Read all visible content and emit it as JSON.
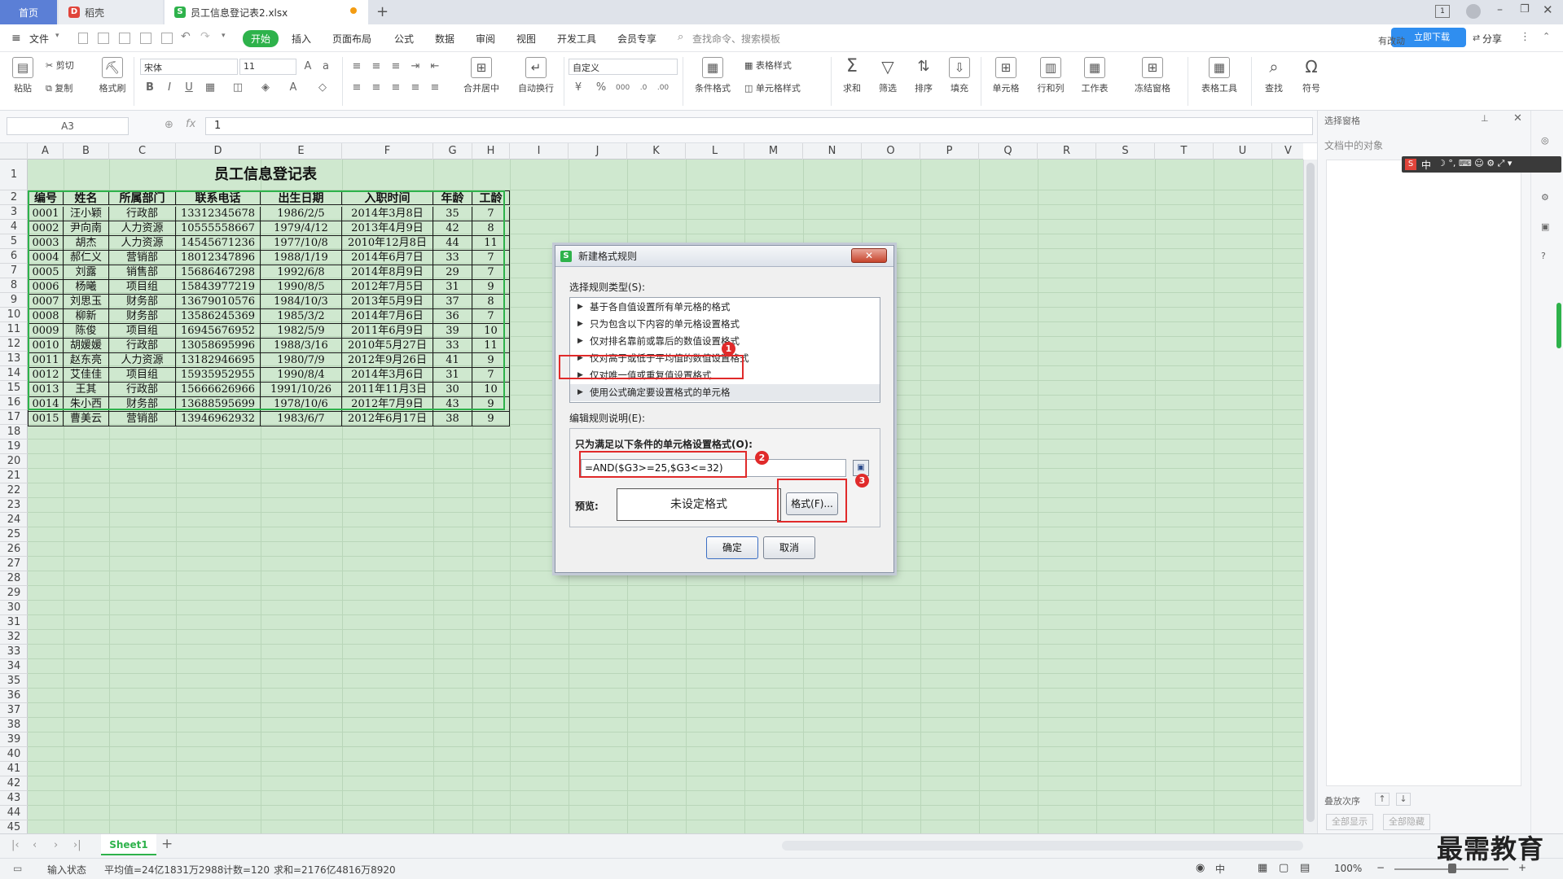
{
  "titlebar": {
    "tabs": [
      {
        "label": "首页"
      },
      {
        "label": "稻壳"
      },
      {
        "label": "员工信息登记表2.xlsx"
      }
    ],
    "new_tab": "+"
  },
  "menubar": {
    "file": "文件",
    "items": [
      "开始",
      "插入",
      "页面布局",
      "公式",
      "数据",
      "审阅",
      "视图",
      "开发工具",
      "会员专享"
    ],
    "search_placeholder": "查找命令、搜索模板",
    "right_items": [
      "有改动",
      "分享"
    ],
    "float_btn": "立即下载"
  },
  "ribbon": {
    "paste": "粘贴",
    "cut": "剪切",
    "copy": "复制",
    "format_painter": "格式刷",
    "font_name": "宋体",
    "font_size": "11",
    "merge_center": "合并居中",
    "wrap_text": "自动换行",
    "number_format": "自定义",
    "table_style": "表格样式",
    "cond_format": "条件格式",
    "cell_style": "单元格样式",
    "sum": "求和",
    "filter": "筛选",
    "sort": "排序",
    "fill": "填充",
    "cell": "单元格",
    "row_col": "行和列",
    "worksheet": "工作表",
    "freeze": "冻结窗格",
    "table_tools": "表格工具",
    "find": "查找",
    "symbol": "符号"
  },
  "formulabar": {
    "name_box": "A3",
    "fx": "fx",
    "value": "1"
  },
  "sheet": {
    "title": "员工信息登记表",
    "columns": [
      "A",
      "B",
      "C",
      "D",
      "E",
      "F",
      "G",
      "H",
      "I",
      "J",
      "K",
      "L",
      "M",
      "N",
      "O",
      "P",
      "Q",
      "R",
      "S",
      "T",
      "U",
      "V"
    ],
    "headers": [
      "编号",
      "姓名",
      "所属部门",
      "联系电话",
      "出生日期",
      "入职时间",
      "年龄",
      "工龄"
    ],
    "rows": [
      [
        "0001",
        "汪小颖",
        "行政部",
        "13312345678",
        "1986/2/5",
        "2014年3月8日",
        "35",
        "7"
      ],
      [
        "0002",
        "尹向南",
        "人力资源",
        "10555558667",
        "1979/4/12",
        "2013年4月9日",
        "42",
        "8"
      ],
      [
        "0003",
        "胡杰",
        "人力资源",
        "14545671236",
        "1977/10/8",
        "2010年12月8日",
        "44",
        "11"
      ],
      [
        "0004",
        "郝仁义",
        "营销部",
        "18012347896",
        "1988/1/19",
        "2014年6月7日",
        "33",
        "7"
      ],
      [
        "0005",
        "刘露",
        "销售部",
        "15686467298",
        "1992/6/8",
        "2014年8月9日",
        "29",
        "7"
      ],
      [
        "0006",
        "杨曦",
        "项目组",
        "15843977219",
        "1990/8/5",
        "2012年7月5日",
        "31",
        "9"
      ],
      [
        "0007",
        "刘思玉",
        "财务部",
        "13679010576",
        "1984/10/3",
        "2013年5月9日",
        "37",
        "8"
      ],
      [
        "0008",
        "柳新",
        "财务部",
        "13586245369",
        "1985/3/2",
        "2014年7月6日",
        "36",
        "7"
      ],
      [
        "0009",
        "陈俊",
        "项目组",
        "16945676952",
        "1982/5/9",
        "2011年6月9日",
        "39",
        "10"
      ],
      [
        "0010",
        "胡媛媛",
        "行政部",
        "13058695996",
        "1988/3/16",
        "2010年5月27日",
        "33",
        "11"
      ],
      [
        "0011",
        "赵东亮",
        "人力资源",
        "13182946695",
        "1980/7/9",
        "2012年9月26日",
        "41",
        "9"
      ],
      [
        "0012",
        "艾佳佳",
        "项目组",
        "15935952955",
        "1990/8/4",
        "2014年3月6日",
        "31",
        "7"
      ],
      [
        "0013",
        "王其",
        "行政部",
        "15666626966",
        "1991/10/26",
        "2011年11月3日",
        "30",
        "10"
      ],
      [
        "0014",
        "朱小西",
        "财务部",
        "13688595699",
        "1978/10/6",
        "2012年7月9日",
        "43",
        "9"
      ],
      [
        "0015",
        "曹美云",
        "营销部",
        "13946962932",
        "1983/6/7",
        "2012年6月17日",
        "38",
        "9"
      ]
    ],
    "row_numbers": [
      "1",
      "2",
      "3",
      "4",
      "5",
      "6",
      "7",
      "8",
      "9",
      "10",
      "11",
      "12",
      "13",
      "14",
      "15",
      "16",
      "17",
      "18",
      "19",
      "20",
      "21",
      "22",
      "23",
      "24",
      "25",
      "26",
      "27",
      "28",
      "29",
      "30",
      "31",
      "32",
      "33",
      "34",
      "35",
      "36",
      "37",
      "38",
      "39",
      "40",
      "41",
      "42",
      "43",
      "44",
      "45"
    ]
  },
  "rightpanel": {
    "title": "选择窗格",
    "subtitle": "文档中的对象",
    "order_label": "叠放次序",
    "show_all": "全部显示",
    "hide_all": "全部隐藏"
  },
  "ime_bar": "中",
  "dialog": {
    "title": "新建格式规则",
    "select_type_label": "选择规则类型(S):",
    "rule_types": [
      "基于各自值设置所有单元格的格式",
      "只为包含以下内容的单元格设置格式",
      "仅对排名靠前或靠后的数值设置格式",
      "仅对高于或低于平均值的数值设置格式",
      "仅对唯一值或重复值设置格式",
      "使用公式确定要设置格式的单元格"
    ],
    "edit_desc_label": "编辑规则说明(E):",
    "condition_label": "只为满足以下条件的单元格设置格式(O):",
    "formula": "=AND($G3>=25,$G3<=32)",
    "preview_label": "预览:",
    "preview_text": "未设定格式",
    "format_button": "格式(F)...",
    "ok": "确定",
    "cancel": "取消",
    "badges": [
      "1",
      "2",
      "3"
    ]
  },
  "sheettabs": {
    "active": "Sheet1",
    "add": "+"
  },
  "statusbar": {
    "mode": "输入状态",
    "average": "平均值=24亿1831万2988",
    "count": "计数=120",
    "sum": "求和=2176亿4816万8920",
    "zoom": "100%"
  },
  "watermark": "最需教育",
  "colors": {
    "accent_green": "#2eb24b",
    "home_tab": "#5b7fd6",
    "grid_bg": "#cfe8cf",
    "highlight_red": "#e02a2a"
  }
}
